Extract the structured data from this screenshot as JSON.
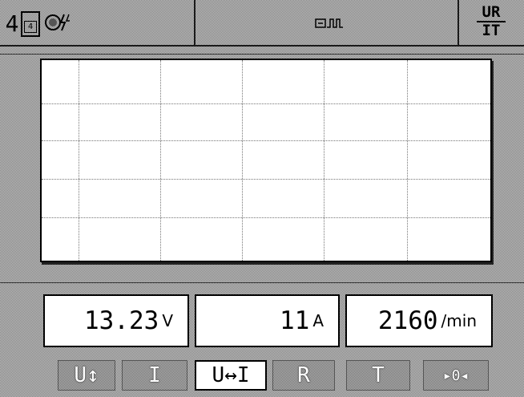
{
  "header": {
    "channel_number": "4",
    "channel_box_icon": "channel-box-icon",
    "channel_box_value": "4",
    "probe_status_icon": "probe-status-icon",
    "trigger_icon": "trigger-pulse-icon",
    "mode_label_top": "UR",
    "mode_label_bottom": "IT"
  },
  "plot": {
    "grid_columns": 6,
    "grid_rows": 5
  },
  "readouts": {
    "voltage": {
      "value": "13.23",
      "unit": "V"
    },
    "current": {
      "value": "11",
      "unit": "A"
    },
    "speed": {
      "value": "2160",
      "unit": "/min"
    }
  },
  "buttons": [
    {
      "label": "U↕",
      "name": "voltage-mode-button",
      "selected": false
    },
    {
      "label": "I",
      "name": "current-mode-button",
      "selected": false
    },
    {
      "label": "U↔I",
      "name": "voltage-current-mode-button",
      "selected": true
    },
    {
      "label": "R",
      "name": "resistance-mode-button",
      "selected": false
    },
    {
      "label": "T",
      "name": "time-mode-button",
      "selected": false
    },
    {
      "label": "▸0◂",
      "name": "zero-button",
      "selected": false
    }
  ]
}
